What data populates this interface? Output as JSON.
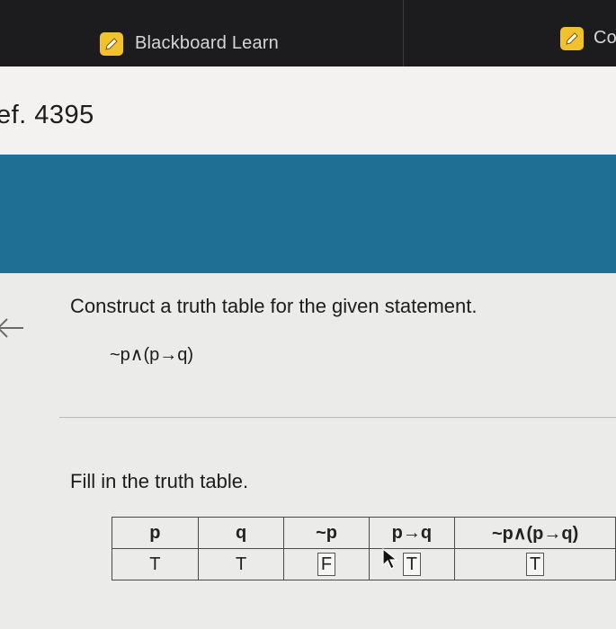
{
  "browser": {
    "tabs": [
      {
        "title": "Blackboard Learn",
        "icon": "pencil-icon"
      },
      {
        "title": "Co",
        "icon": "pencil-icon"
      }
    ]
  },
  "reference": {
    "text": "ef. 4395"
  },
  "question": {
    "prompt": "Construct a truth table for the given statement.",
    "statement": "~p∧(p→q)"
  },
  "instruction": "Fill in the truth table.",
  "truth_table": {
    "headers": [
      "p",
      "q",
      "~p",
      "p→q",
      "~p∧(p→q)"
    ],
    "rows": [
      [
        "T",
        "T",
        "F",
        "T",
        "T"
      ]
    ]
  },
  "colors": {
    "banner": "#1f6f94",
    "tab_bar": "#1c1c1e",
    "tab_icon": "#f2c12e"
  }
}
